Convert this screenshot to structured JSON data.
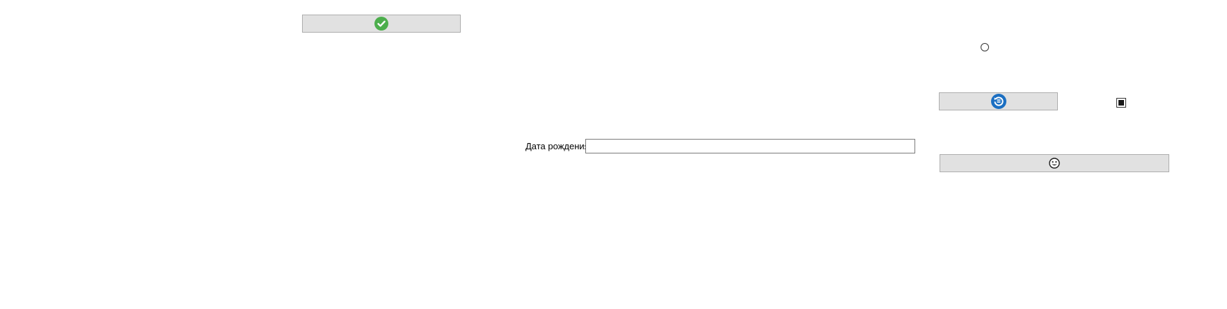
{
  "form": {
    "birth_date_label": "Дата рождения",
    "birth_date_value": "",
    "birth_date_placeholder": ""
  },
  "buttons": {
    "confirm": {
      "icon": "check-circle-icon",
      "label": ""
    },
    "refresh": {
      "icon": "refresh-icon",
      "label": ""
    },
    "emoji": {
      "icon": "smiley-face-icon",
      "label": ""
    }
  },
  "controls": {
    "radio": {
      "checked": false
    },
    "checkbox": {
      "state": "indeterminate"
    }
  },
  "colors": {
    "button_bg": "#e1e1e1",
    "button_border": "#adadad",
    "confirm_icon": "#4cae4c",
    "refresh_icon": "#1b6fc2"
  }
}
